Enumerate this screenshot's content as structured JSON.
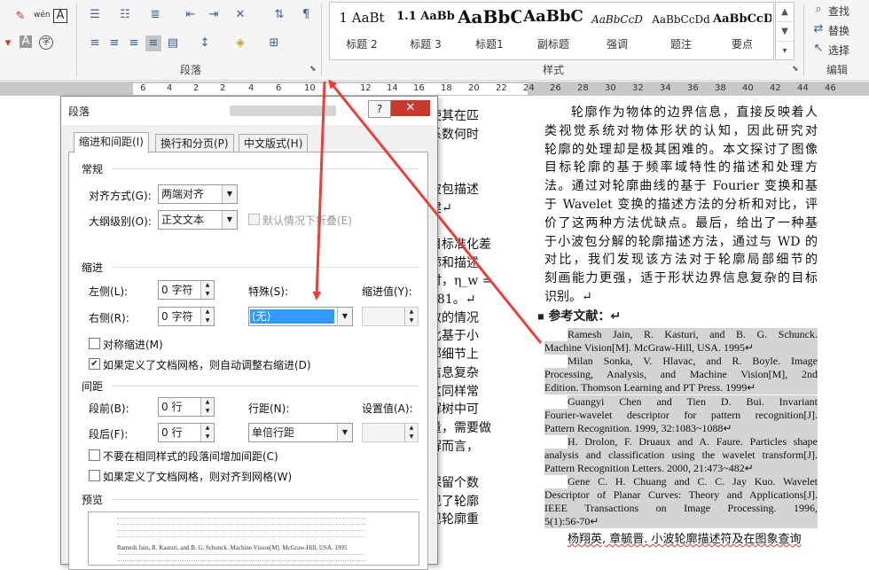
{
  "ribbon": {
    "font_icons": [
      {
        "label": "wén",
        "icon": "phonetic-guide-icon"
      },
      {
        "label": "A",
        "icon": "char-border-icon"
      },
      {
        "label": "字",
        "icon": "enclose-char-icon"
      }
    ],
    "groups": {
      "paragraph": "段落",
      "styles": "样式",
      "editing": "编辑"
    },
    "styles": [
      {
        "sample": "1 AaBt",
        "name": "标题 2"
      },
      {
        "sample": "1.1 AaBb",
        "name": "标题 3"
      },
      {
        "sample": "AaBbC",
        "name": "标题1"
      },
      {
        "sample": "AaBbC",
        "name": "副标题"
      },
      {
        "sample": "AaBbCcD",
        "name": "强调"
      },
      {
        "sample": "AaBbCcDd",
        "name": "题注"
      },
      {
        "sample": "AaBbCcD",
        "name": "要点"
      }
    ],
    "editing": {
      "find": "查找",
      "replace": "替换",
      "select": "选择"
    }
  },
  "ruler": {
    "numbers": [
      "6",
      "4",
      "2",
      "2",
      "4",
      "6",
      "10",
      "12",
      "14",
      "16",
      "18",
      "20",
      "22",
      "24",
      "26",
      "28",
      "30",
      "32",
      "34",
      "36",
      "38",
      "40",
      "42",
      "44",
      "46"
    ]
  },
  "dialog": {
    "title": "段落",
    "help": "?",
    "close": "✕",
    "tabs": [
      "缩进和间距(I)",
      "换行和分页(P)",
      "中文版式(H)"
    ],
    "general": {
      "heading": "常规",
      "alignment_label": "对齐方式(G):",
      "alignment_value": "两端对齐",
      "outline_label": "大纲级别(O):",
      "outline_value": "正文文本",
      "collapse_label": "默认情况下折叠(E)"
    },
    "indent": {
      "heading": "缩进",
      "left_label": "左侧(L):",
      "left_value": "0 字符",
      "right_label": "右侧(R):",
      "right_value": "0 字符",
      "special_label": "特殊(S):",
      "special_value": "(无)",
      "by_label": "缩进值(Y):",
      "mirror_label": "对称缩进(M)",
      "auto_adjust_label": "如果定义了文档网格，则自动调整右缩进(D)"
    },
    "spacing": {
      "heading": "间距",
      "before_label": "段前(B):",
      "before_value": "0 行",
      "after_label": "段后(F):",
      "after_value": "0 行",
      "line_label": "行距(N):",
      "line_value": "单倍行距",
      "at_label": "设置值(A):",
      "no_space_label": "不要在相同样式的段落间增加间距(C)",
      "snap_grid_label": "如果定义了文档网格，则对齐到网格(W)"
    },
    "preview": {
      "heading": "预览",
      "sample": "Ramesh Jain, R. Kasturi, and B. G. Schunck. Machine Vision[M]. McGraw-Hill, USA. 1995"
    }
  },
  "document": {
    "left_column": [
      "使其在匹",
      "系数何时",
      "",
      "",
      "波包描述",
      "建↵",
      "",
      "目标准化差",
      "廓和描述",
      "时，η_w =",
      "281。↵",
      "数的情况",
      "比基于小",
      "部细节上",
      "信息复杂",
      "这同样常",
      "解树中可",
      "量，需要做",
      "解而言，",
      "",
      "保留个数",
      "现了轮廓",
      "现轮廓重"
    ],
    "abstract": [
      "轮廓作为物体的边界信息，直接反映着人",
      "类视觉系统对物体形状的认知，因此研究对",
      "轮廓的处理却是极其困难的。本文探讨了图像",
      "目标轮廓的基于频率域特性的描述和处理方",
      "法。通过对轮廓曲线的基于 Fourier 变换和基",
      "于 Wavelet 变换的描述方法的分析和对比，评",
      "价了这两种方法优缺点。最后，给出了一种基",
      "于小波包分解的轮廓描述方法，通过与 WD 的",
      "对比，我们发现该方法对于轮廓局部细节的",
      "刻画能力更强，适于形状边界信息复杂的目标",
      "识别。↵"
    ],
    "refs_heading": "参考文献：↵",
    "references": [
      "Ramesh Jain, R. Kasturi, and B. G. Schunck.",
      "Machine Vision[M]. McGraw-Hill, USA. 1995↵",
      "Milan Sonka, V. Hlavac, and R. Boyle. Image",
      "Processing, Analysis, and Machine Vision[M], 2nd",
      "Edition. Thomson Learning and PT Press. 1999↵",
      "Guangyi Chen and Tien D. Bui. Invariant",
      "Fourier-wavelet descriptor for pattern recognition[J].",
      "Pattern Recognition. 1999, 32:1083~1088↵",
      "H. Drolon, F. Druaux and A. Faure. Particles shape",
      "analysis and classification using the wavelet transform[J].",
      "Pattern Recognition Letters. 2000, 21:473~482↵",
      "Gene C. H. Chuang and C. C. Jay Kuo. Wavelet",
      "Descriptor of Planar Curves: Theory and Applications[J].",
      "IEEE Transactions on Image Processing. 1996,",
      "5(1):56-70↵"
    ],
    "last_ref": "杨翔英, 章毓晋. 小波轮廓描述符及在图象查询"
  },
  "colors": {
    "arrow": "#e8413b",
    "selection": "#3399ff",
    "close_button": "#c8392c",
    "ref_highlight": "#d4d4d4"
  }
}
